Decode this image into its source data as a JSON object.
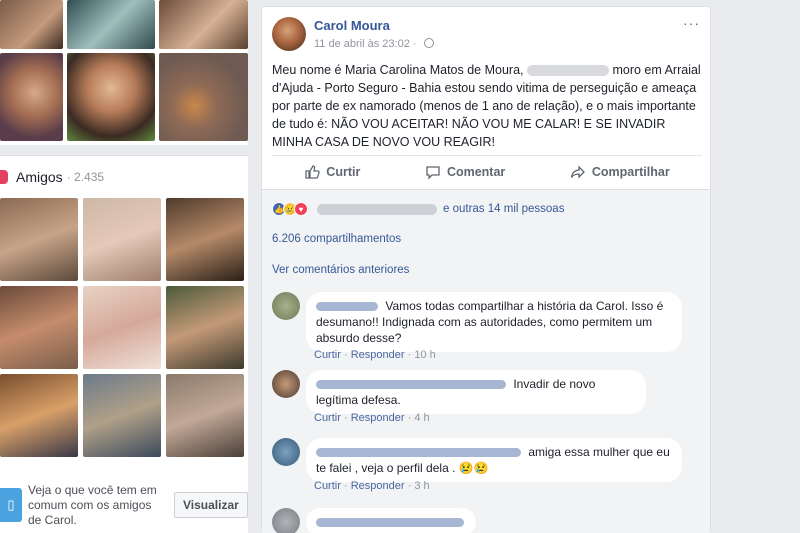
{
  "friends": {
    "title": "Amigos",
    "count": "· 2.435",
    "mutual_text": "Veja o que você tem em comum com os amigos de Carol.",
    "view_button": "Visualizar"
  },
  "post": {
    "author": "Carol Moura",
    "date": "11 de abril às 23:02 ·",
    "more": "···",
    "text_part1": "Meu nome é Maria Carolina Matos de Moura,",
    "text_part2": "moro em Arraial d'Ajuda - Porto Seguro - Bahia estou sendo vitima de perseguição e ameaça por parte de ex namorado (menos de 1 ano de relação), e o mais importante de tudo é: NÃO VOU ACEITAR! NÃO VOU ME CALAR! E SE INVADIR MINHA CASA DE NOVO VOU REAGIR!",
    "actions": {
      "like": "Curtir",
      "comment": "Comentar",
      "share": "Compartilhar"
    },
    "reactions_text": "e outras 14 mil pessoas",
    "shares": "6.206 compartilhamentos",
    "previous_comments": "Ver comentários anteriores"
  },
  "comments": [
    {
      "text": "Vamos todas compartilhar a história da Carol. Isso é desumano!! Indignada com as autoridades, como permitem um absurdo desse?",
      "like": "Curtir",
      "reply": "Responder",
      "sep": "·",
      "time": "10 h"
    },
    {
      "text": "Invadir de novo legítima defesa.",
      "like": "Curtir",
      "reply": "Responder",
      "sep": "·",
      "time": "4 h"
    },
    {
      "text": "amiga essa mulher que eu te falei , veja o perfil dela . 😢😢",
      "like": "Curtir",
      "reply": "Responder",
      "sep": "·",
      "time": "3 h"
    }
  ],
  "colors": {
    "link": "#365899",
    "background": "#e9ebee",
    "like_blue": "#4267b2"
  },
  "icons": {
    "like": "thumbs-up-icon",
    "comment": "speech-bubble-icon",
    "share": "share-arrow-icon"
  }
}
